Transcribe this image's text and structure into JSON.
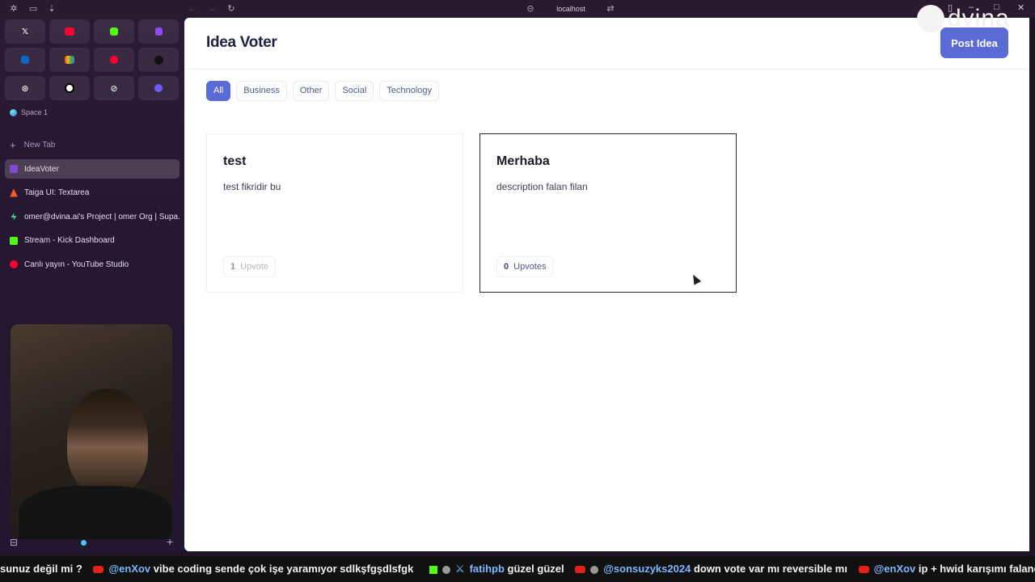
{
  "browser": {
    "url": "localhost"
  },
  "sidebar": {
    "space_label": "Space 1",
    "new_tab_label": "New Tab",
    "tabs": [
      {
        "label": "IdeaVoter",
        "color": "#7b4bd6"
      },
      {
        "label": "Taiga UI: Textarea",
        "color": "#ff5722"
      },
      {
        "label": "omer@dvina.ai's Project | omer Org | Supa...",
        "color": "#3ecf8e"
      },
      {
        "label": "Stream - Kick Dashboard",
        "color": "#53fc18"
      },
      {
        "label": "Canlı yayın - YouTube Studio",
        "color": "#ff0033"
      }
    ],
    "favorites": [
      "x-icon",
      "youtube-icon",
      "kick-icon",
      "twitch-icon",
      "linkedin-icon",
      "gmail-icon",
      "youtube-music-icon",
      "upwork-icon",
      "chatgpt-icon",
      "circle-icon",
      "perplexity-icon",
      "claude-icon"
    ]
  },
  "app": {
    "title": "Idea Voter",
    "post_button": "Post Idea",
    "accent": "#5b6bd6",
    "filters": [
      "All",
      "Business",
      "Other",
      "Social",
      "Technology"
    ],
    "active_filter": "All",
    "ideas": [
      {
        "title": "test",
        "description": "test fikridir bu",
        "votes": "1",
        "vote_label": "Upvote"
      },
      {
        "title": "Merhaba",
        "description": "description falan filan",
        "votes": "0",
        "vote_label": "Upvotes"
      }
    ]
  },
  "watermark": "dvina",
  "chat_ticker": [
    {
      "user": "",
      "text": "sunuz değil mi ?",
      "platform": ""
    },
    {
      "user": "@enXov",
      "text": "vibe coding sende çok işe yaramıyor sdlkşfgşdlsfgk",
      "platform": "youtube"
    },
    {
      "user": "fatihpb",
      "text": "güzel güzel",
      "platform": "kick"
    },
    {
      "user": "@sonsuzyks2024",
      "text": "down vote var mı reversible mı",
      "platform": "youtube"
    },
    {
      "user": "@enXov",
      "text": "ip + hwid karışımı falandır ya",
      "platform": "youtube"
    }
  ]
}
